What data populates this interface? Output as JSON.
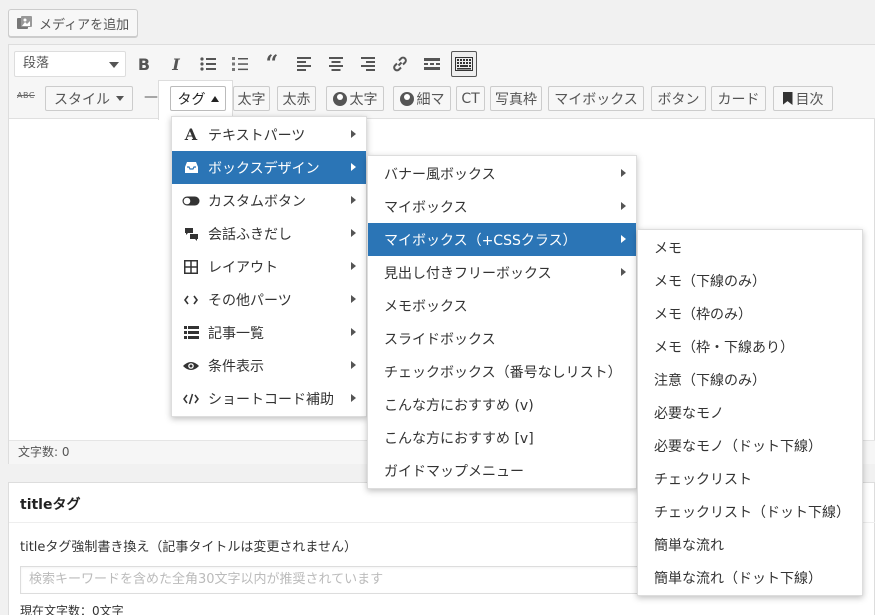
{
  "media_button": {
    "label": "メディアを追加"
  },
  "toolbar_row1": {
    "format_select": {
      "value": "段落"
    },
    "buttons": [
      "bold",
      "italic",
      "bullet-list",
      "numbered-list",
      "blockquote",
      "align-left",
      "align-center",
      "align-right",
      "link",
      "read-more",
      "toolbar-toggle"
    ],
    "bold_label": "B",
    "italic_label": "I"
  },
  "toolbar_row2": {
    "strike_icon_label": "ABC",
    "style_button": "スタイル",
    "dash_label": "—",
    "tag_button": "タグ",
    "buttons": [
      "太字",
      "太赤",
      "太字",
      "細マ",
      "CT",
      "写真枠",
      "マイボックス",
      "ボタン",
      "カード",
      "目次"
    ]
  },
  "status": {
    "char_count": "文字数: 0"
  },
  "meta_box": {
    "title": "titleタグ",
    "description": "titleタグ強制書き換え（記事タイトルは変更されません）",
    "input_placeholder": "検索キーワードを含めた全角30文字以内が推奨されています",
    "char_count": "現在文字数：0文字"
  },
  "menu1": {
    "items": [
      {
        "label": "テキストパーツ",
        "icon": "text-a-icon"
      },
      {
        "label": "ボックスデザイン",
        "icon": "inbox-icon"
      },
      {
        "label": "カスタムボタン",
        "icon": "toggle-icon"
      },
      {
        "label": "会話ふきだし",
        "icon": "chat-bubbles-icon"
      },
      {
        "label": "レイアウト",
        "icon": "grid-icon"
      },
      {
        "label": "その他パーツ",
        "icon": "code-icon"
      },
      {
        "label": "記事一覧",
        "icon": "list-icon"
      },
      {
        "label": "条件表示",
        "icon": "eye-icon"
      },
      {
        "label": "ショートコード補助",
        "icon": "code-slash-icon"
      }
    ],
    "active": "ボックスデザイン"
  },
  "menu2": {
    "items": [
      "バナー風ボックス",
      "マイボックス",
      "マイボックス（+CSSクラス）",
      "見出し付きフリーボックス",
      "メモボックス",
      "スライドボックス",
      "チェックボックス（番号なしリスト）",
      "こんな方におすすめ (v)",
      "こんな方におすすめ [v]",
      "ガイドマップメニュー"
    ],
    "active": "マイボックス（+CSSクラス）"
  },
  "menu3": {
    "items": [
      "メモ",
      "メモ（下線のみ）",
      "メモ（枠のみ）",
      "メモ（枠・下線あり）",
      "注意（下線のみ）",
      "必要なモノ",
      "必要なモノ（ドット下線）",
      "チェックリスト",
      "チェックリスト（ドット下線）",
      "簡単な流れ",
      "簡単な流れ（ドット下線）"
    ]
  },
  "colors": {
    "active_menu_bg": "#2b75b6",
    "background": "#f1f1f1"
  }
}
